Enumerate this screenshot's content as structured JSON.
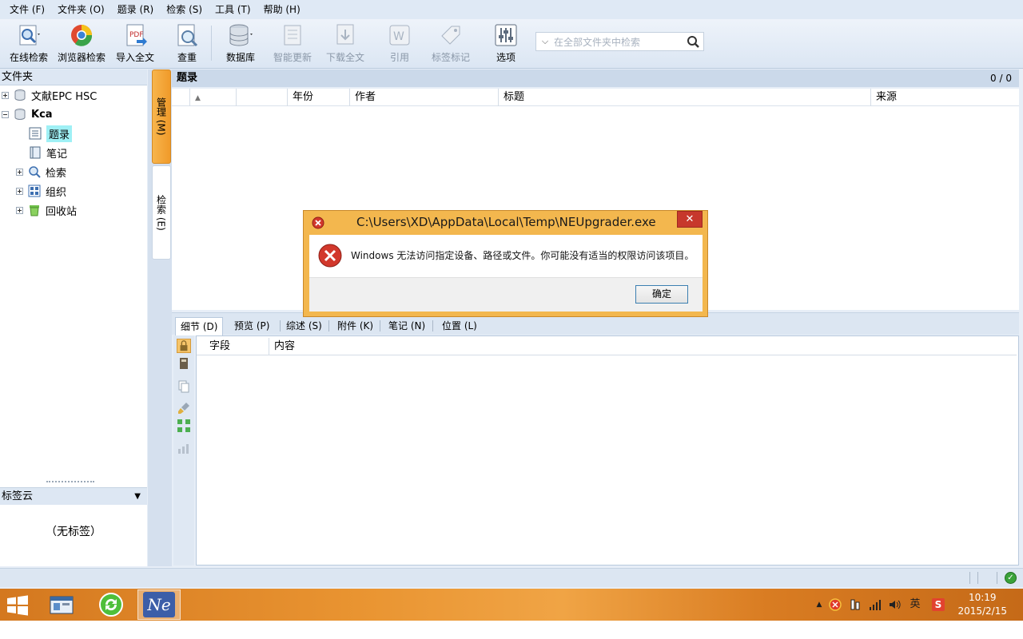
{
  "menu": [
    "文件 (F)",
    "文件夹 (O)",
    "题录 (R)",
    "检索 (S)",
    "工具 (T)",
    "帮助 (H)"
  ],
  "toolbar": {
    "online_search": "在线检索",
    "browser_search": "浏览器检索",
    "import_fulltext": "导入全文",
    "dedupe": "查重",
    "database": "数据库",
    "smart_update": "智能更新",
    "download_fulltext": "下载全文",
    "cite": "引用",
    "tag_mark": "标签标记",
    "options": "选项"
  },
  "search": {
    "placeholder": "在全部文件夹中检索"
  },
  "left_panel": {
    "header": "文件夹",
    "tree": [
      "文献EPC HSC",
      "Kca",
      "题录",
      "笔记",
      "检索",
      "组织",
      "回收站"
    ],
    "tag_cloud_header": "标签云",
    "no_tags": "（无标签）"
  },
  "vtabs": {
    "manage": "管理 (M)",
    "search": "检索 (E)"
  },
  "records": {
    "title": "题录",
    "count": "0 / 0",
    "columns": [
      "年份",
      "作者",
      "标题",
      "来源"
    ]
  },
  "detail_tabs": [
    "细节 (D)",
    "预览 (P)",
    "综述 (S)",
    "附件 (K)",
    "笔记 (N)",
    "位置 (L)"
  ],
  "detail_columns": [
    "字段",
    "内容"
  ],
  "dialog": {
    "title": "C:\\Users\\XD\\AppData\\Local\\Temp\\NEUpgrader.exe",
    "message": "Windows 无法访问指定设备、路径或文件。你可能没有适当的权限访问该项目。",
    "ok": "确定",
    "close": "✕"
  },
  "taskbar": {
    "app_ne": "Ne",
    "ime": "英",
    "time": "10:19",
    "date": "2015/2/15"
  },
  "colors": {
    "accent_orange": "#f09a2a",
    "error_red": "#c7382c",
    "taskbar": "#e99431"
  }
}
